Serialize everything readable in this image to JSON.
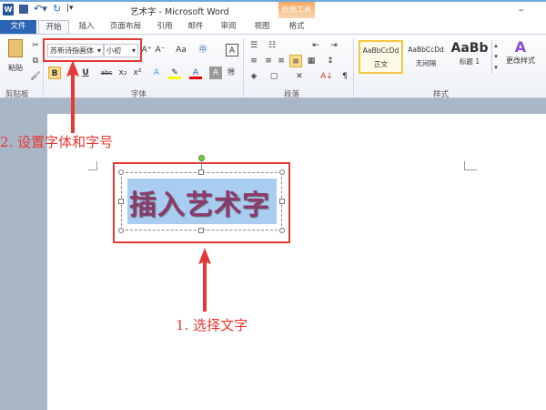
{
  "titlebar": {
    "title": "艺术字 - Microsoft Word",
    "context_tab": "绘图工具",
    "minimize": "–"
  },
  "tabs": [
    {
      "label": "文件"
    },
    {
      "label": "开始"
    },
    {
      "label": "插入"
    },
    {
      "label": "页面布局"
    },
    {
      "label": "引用"
    },
    {
      "label": "邮件"
    },
    {
      "label": "审阅"
    },
    {
      "label": "视图"
    },
    {
      "label": "格式"
    }
  ],
  "ribbon": {
    "clipboard": {
      "paste": "粘贴",
      "label": "剪贴板"
    },
    "font": {
      "font_name": "苏新诗指画体",
      "font_size": "小初",
      "label": "字体",
      "bold": "B",
      "italic": "I",
      "underline": "U",
      "strike": "abc",
      "sub": "x₂",
      "sup": "x²",
      "grow": "A⁺",
      "shrink": "A⁻",
      "case": "Aa",
      "color": "A"
    },
    "paragraph": {
      "label": "段落"
    },
    "styles": {
      "label": "样式",
      "items": [
        {
          "preview": "AaBbCcDd",
          "name": "正文"
        },
        {
          "preview": "AaBbCcDd",
          "name": "无间隔"
        },
        {
          "preview": "AaBb",
          "name": "标题 1"
        }
      ],
      "change": "更改样式"
    }
  },
  "document": {
    "wordart_text": "插入艺术字"
  },
  "annotations": {
    "step2": "2. 设置字体和字号",
    "step1": "1. 选择文字"
  },
  "colors": {
    "accent": "#2b579a",
    "annotation": "#e53935",
    "wordart": "#8b3a6e",
    "selection": "#a9cdf0"
  }
}
